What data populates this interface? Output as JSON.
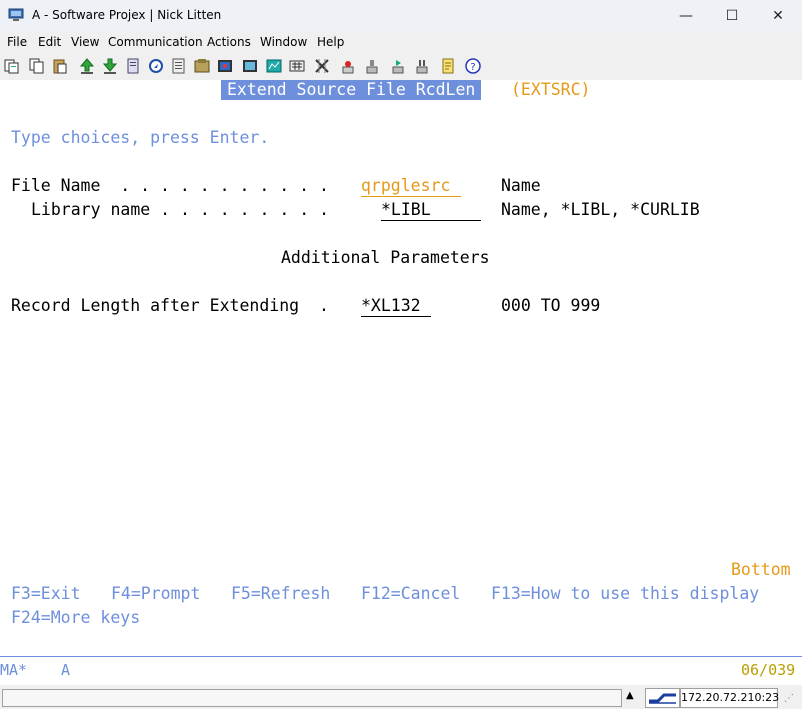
{
  "window": {
    "title": "A - Software Projex | Nick Litten",
    "minimize_glyph": "—",
    "maximize_glyph": "☐",
    "close_glyph": "✕"
  },
  "menu": [
    "File",
    "Edit",
    "View",
    "Communication",
    "Actions",
    "Window",
    "Help"
  ],
  "toolbar_icons": [
    "copy-icon",
    "copy-append-icon",
    "paste-icon",
    "send-file-icon",
    "receive-file-icon",
    "print-screen-icon",
    "record-macro-icon",
    "play-macro-icon",
    "display-icon",
    "bug-icon",
    "macro-record-icon",
    "chart-icon",
    "keyboard-map-icon",
    "grid-icon",
    "tools-icon",
    "record-icon",
    "stop-icon",
    "play-icon",
    "pause-icon",
    "notes-icon",
    "help-icon"
  ],
  "screen": {
    "header_title": "Extend Source File RcdLen",
    "command": "(EXTSRC)",
    "instruction": "Type choices, press Enter.",
    "file_name_label": "File Name  . . . . . . . . . . .",
    "file_name_value": "qrpglesrc",
    "file_name_hint": "Name",
    "library_label": "Library name . . . . . . . . .",
    "library_value": "*LIBL",
    "library_hint": "Name, *LIBL, *CURLIB",
    "additional_heading": "Additional Parameters",
    "record_length_label": "Record Length after Extending  .",
    "record_length_value": "*XL132",
    "record_length_hint": "000 TO 999",
    "bottom_indicator": "Bottom",
    "fkeys_line1": [
      "F3=Exit",
      "F4=Prompt",
      "F5=Refresh",
      "F12=Cancel",
      "F13=How to use this display"
    ],
    "fkeys_line2": [
      "F24=More keys"
    ]
  },
  "oia": {
    "session_indicator": "MA*",
    "session_letter": "A",
    "cursor_position": "06/039"
  },
  "statusbar": {
    "ip_address": "172.20.72.210:23"
  },
  "colors": {
    "blue": "#6e8fdc",
    "orange": "#e59a1a"
  }
}
